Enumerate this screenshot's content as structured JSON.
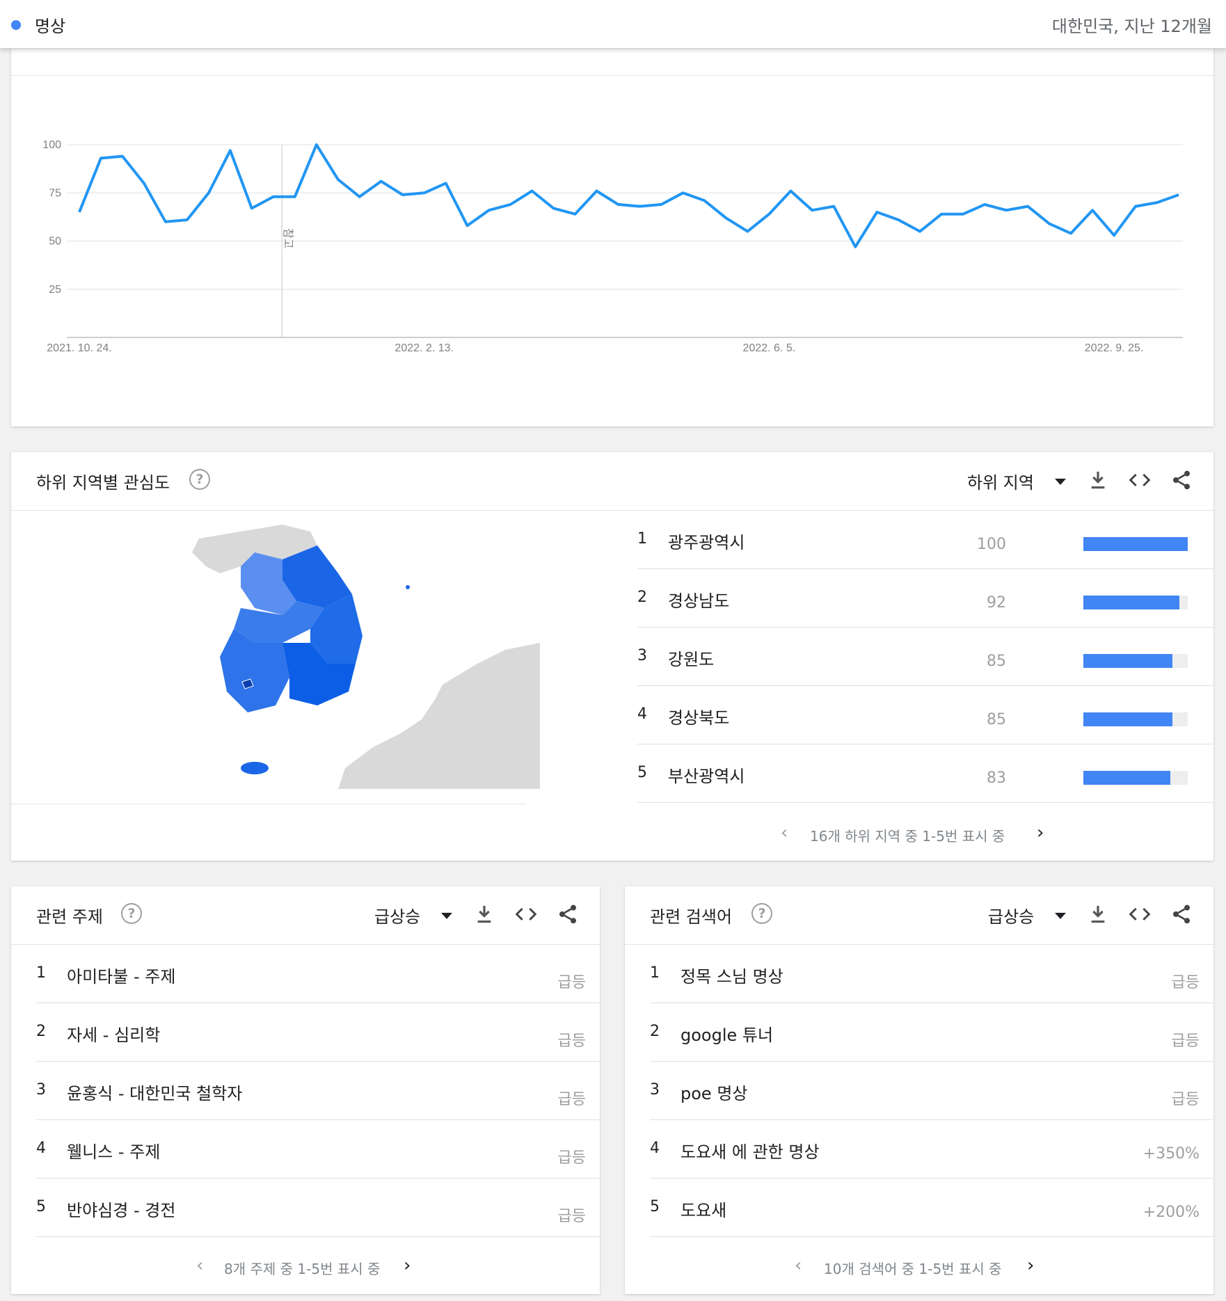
{
  "topbar": {
    "term": "명상",
    "region_period": "대한민국, 지난 12개월",
    "term_color": "#4285f4"
  },
  "interest_over_time": {
    "note_label": "참고",
    "chart_data": {
      "type": "line",
      "title": "",
      "series": [
        {
          "color": "#2196f3",
          "values": [
            65,
            93,
            94,
            80,
            60,
            61,
            75,
            97,
            67,
            73,
            73,
            100,
            82,
            73,
            81,
            74,
            75,
            80,
            58,
            66,
            69,
            76,
            67,
            64,
            76,
            69,
            68,
            69,
            75,
            71,
            62,
            55,
            64,
            76,
            66,
            68,
            47,
            65,
            61,
            55,
            64,
            64,
            69,
            66,
            68,
            59,
            54,
            66,
            53,
            68,
            70,
            74
          ]
        }
      ],
      "x_tick_labels": [
        "2021. 10. 24.",
        "2022. 2. 13.",
        "2022. 6. 5.",
        "2022. 9. 25."
      ],
      "y_ticks": [
        25,
        50,
        75,
        100
      ],
      "ylim": [
        0,
        100
      ],
      "grid": true
    }
  },
  "subregion": {
    "title": "하위 지역별 관심도",
    "dropdown_label": "하위 지역",
    "items": [
      {
        "rank": "1",
        "name": "광주광역시",
        "value": "100",
        "fraction": 1.0
      },
      {
        "rank": "2",
        "name": "경상남도",
        "value": "92",
        "fraction": 0.92
      },
      {
        "rank": "3",
        "name": "강원도",
        "value": "85",
        "fraction": 0.85
      },
      {
        "rank": "4",
        "name": "경상북도",
        "value": "85",
        "fraction": 0.85
      },
      {
        "rank": "5",
        "name": "부산광역시",
        "value": "83",
        "fraction": 0.83
      }
    ],
    "pager_text": "16개 하위 지역 중 1-5번 표시 중",
    "bar_color": "#4285f4"
  },
  "related_topics": {
    "title": "관련 주제",
    "dropdown_label": "급상승",
    "items": [
      {
        "rank": "1",
        "name": "아미타불 - 주제",
        "value": "급등"
      },
      {
        "rank": "2",
        "name": "자세 - 심리학",
        "value": "급등"
      },
      {
        "rank": "3",
        "name": "윤홍식 - 대한민국 철학자",
        "value": "급등"
      },
      {
        "rank": "4",
        "name": "웰니스 - 주제",
        "value": "급등"
      },
      {
        "rank": "5",
        "name": "반야심경 - 경전",
        "value": "급등"
      }
    ],
    "pager_text": "8개 주제 중 1-5번 표시 중"
  },
  "related_queries": {
    "title": "관련 검색어",
    "dropdown_label": "급상승",
    "items": [
      {
        "rank": "1",
        "name": "정목 스님 명상",
        "value": "급등"
      },
      {
        "rank": "2",
        "name": "google 튜너",
        "value": "급등"
      },
      {
        "rank": "3",
        "name": "poe 명상",
        "value": "급등"
      },
      {
        "rank": "4",
        "name": "도요새 에 관한 명상",
        "value": "+350%"
      },
      {
        "rank": "5",
        "name": "도요새",
        "value": "+200%"
      }
    ],
    "pager_text": "10개 검색어 중 1-5번 표시 중"
  },
  "icons": {
    "help": "help-icon",
    "download": "download-icon",
    "embed": "embed-code-icon",
    "share": "share-icon",
    "dropdown": "caret-down-icon",
    "prev": "chevron-left-icon",
    "next": "chevron-right-icon"
  },
  "help_glyph": "?",
  "prev_glyph": "‹",
  "next_glyph": "›"
}
